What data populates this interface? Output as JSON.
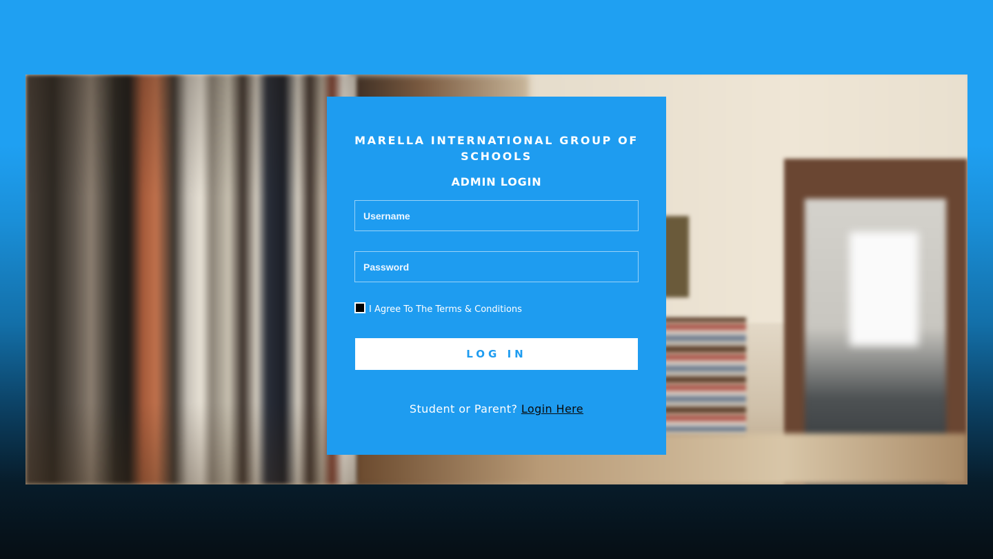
{
  "school": {
    "name": "MARELLA INTERNATIONAL GROUP OF SCHOOLS",
    "subtitle": "ADMIN LOGIN"
  },
  "form": {
    "username_placeholder": "Username",
    "password_placeholder": "Password",
    "agree_label": "I Agree To The Terms & Conditions",
    "agree_checked": false,
    "submit_label": "LOG IN"
  },
  "footer": {
    "prompt": "Student or Parent?",
    "link_label": "Login Here"
  },
  "colors": {
    "accent": "#1e9cf0",
    "button_bg": "#ffffff"
  }
}
